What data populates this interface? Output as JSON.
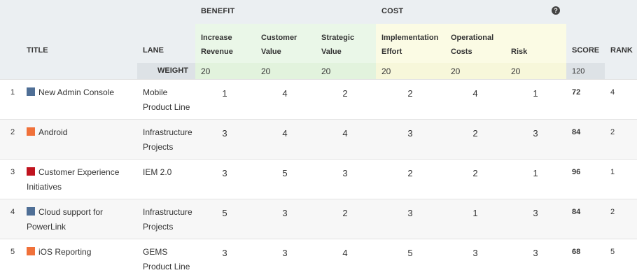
{
  "header": {
    "group_benefit": "BENEFIT",
    "group_cost": "COST",
    "col_title": "TITLE",
    "col_lane": "LANE",
    "col_score": "SCORE",
    "col_rank": "RANK",
    "weight_label": "WEIGHT",
    "total_weight": "120",
    "help_icon": "question-circle-icon"
  },
  "criteria": [
    {
      "line1": "Increase",
      "line2": "Revenue",
      "group": "benefit",
      "weight": "20"
    },
    {
      "line1": "Customer",
      "line2": "Value",
      "group": "benefit",
      "weight": "20"
    },
    {
      "line1": "Strategic",
      "line2": "Value",
      "group": "benefit",
      "weight": "20"
    },
    {
      "line1": "Implementation",
      "line2": "Effort",
      "group": "cost",
      "weight": "20"
    },
    {
      "line1": "Operational",
      "line2": "Costs",
      "group": "cost",
      "weight": "20"
    },
    {
      "line1": "Risk",
      "line2": "",
      "group": "cost",
      "weight": "20"
    }
  ],
  "rows": [
    {
      "index": "1",
      "title": "New Admin Console",
      "color": "#4f6f96",
      "lane": "Mobile Product Line",
      "values": [
        "1",
        "4",
        "2",
        "2",
        "4",
        "1"
      ],
      "score": "72",
      "rank": "4"
    },
    {
      "index": "2",
      "title": "Android",
      "color": "#f0713a",
      "lane": "Infrastructure Projects",
      "values": [
        "3",
        "4",
        "4",
        "3",
        "2",
        "3"
      ],
      "score": "84",
      "rank": "2"
    },
    {
      "index": "3",
      "title": "Customer Experience Initiatives",
      "color": "#c0141f",
      "lane": "IEM 2.0",
      "values": [
        "3",
        "5",
        "3",
        "2",
        "2",
        "1"
      ],
      "score": "96",
      "rank": "1"
    },
    {
      "index": "4",
      "title": "Cloud support for PowerLink",
      "color": "#4f6f96",
      "lane": "Infrastructure Projects",
      "values": [
        "5",
        "3",
        "2",
        "3",
        "1",
        "3"
      ],
      "score": "84",
      "rank": "2"
    },
    {
      "index": "5",
      "title": "iOS Reporting",
      "color": "#f0713a",
      "lane": "GEMS Product Line",
      "values": [
        "3",
        "3",
        "4",
        "5",
        "3",
        "3"
      ],
      "score": "68",
      "rank": "5"
    }
  ]
}
